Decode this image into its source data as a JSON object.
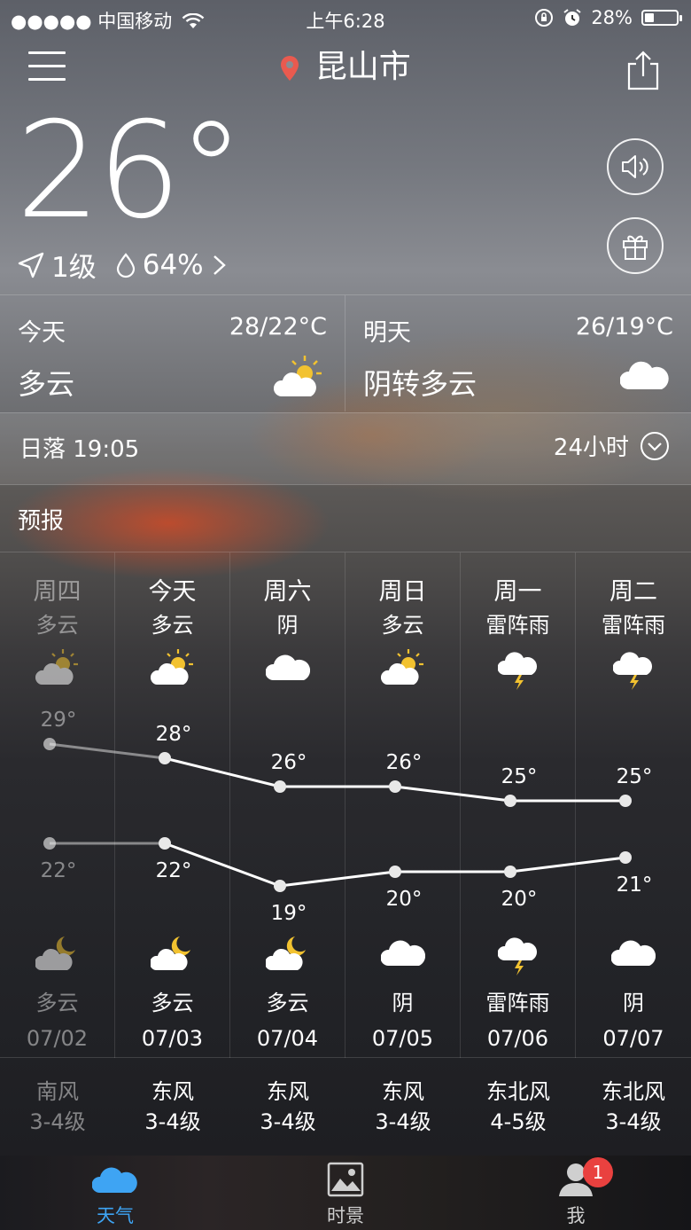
{
  "status_bar": {
    "carrier": "●●●●● 中国移动",
    "time": "上午6:28",
    "battery_text": "28%",
    "battery_level": 0.28
  },
  "header": {
    "city": "昆山市"
  },
  "current": {
    "temperature": "26°",
    "wind": "1级",
    "humidity": "64%"
  },
  "today": {
    "name": "今天",
    "range": "28/22°C",
    "condition": "多云",
    "icon": "partly-cloudy-icon"
  },
  "tomorrow": {
    "name": "明天",
    "range": "26/19°C",
    "condition": "阴转多云",
    "icon": "cloud-icon"
  },
  "sunset": {
    "label": "日落 19:05",
    "hours_toggle": "24小时"
  },
  "forecast_title": "预报",
  "forecast": [
    {
      "weekday": "周四",
      "day_cond": "多云",
      "day_icon": "partly-cloudy-icon",
      "high": "29°",
      "low": "22°",
      "night_icon": "moon-cloud-icon",
      "night_cond": "多云",
      "date": "07/02",
      "wind_dir": "南风",
      "wind_level": "3-4级",
      "past": true
    },
    {
      "weekday": "今天",
      "day_cond": "多云",
      "day_icon": "partly-cloudy-icon",
      "high": "28°",
      "low": "22°",
      "night_icon": "moon-cloud-icon",
      "night_cond": "多云",
      "date": "07/03",
      "wind_dir": "东风",
      "wind_level": "3-4级",
      "past": false
    },
    {
      "weekday": "周六",
      "day_cond": "阴",
      "day_icon": "cloud-icon",
      "high": "26°",
      "low": "19°",
      "night_icon": "moon-cloud-icon",
      "night_cond": "多云",
      "date": "07/04",
      "wind_dir": "东风",
      "wind_level": "3-4级",
      "past": false
    },
    {
      "weekday": "周日",
      "day_cond": "多云",
      "day_icon": "partly-cloudy-icon",
      "high": "26°",
      "low": "20°",
      "night_icon": "cloud-icon",
      "night_cond": "阴",
      "date": "07/05",
      "wind_dir": "东风",
      "wind_level": "3-4级",
      "past": false
    },
    {
      "weekday": "周一",
      "day_cond": "雷阵雨",
      "day_icon": "thunder-cloud-icon",
      "high": "25°",
      "low": "20°",
      "night_icon": "thunder-cloud-icon",
      "night_cond": "雷阵雨",
      "date": "07/06",
      "wind_dir": "东北风",
      "wind_level": "4-5级",
      "past": false
    },
    {
      "weekday": "周二",
      "day_cond": "雷阵雨",
      "day_icon": "thunder-cloud-icon",
      "high": "25°",
      "low": "21°",
      "night_icon": "cloud-icon",
      "night_cond": "阴",
      "date": "07/07",
      "wind_dir": "东北风",
      "wind_level": "3-4级",
      "past": false
    }
  ],
  "chart_data": {
    "type": "line",
    "categories": [
      "07/02",
      "07/03",
      "07/04",
      "07/05",
      "07/06",
      "07/07"
    ],
    "series": [
      {
        "values": [
          29,
          28,
          26,
          26,
          25,
          25
        ]
      },
      {
        "values": [
          22,
          22,
          19,
          20,
          20,
          21
        ]
      }
    ]
  },
  "tabs": [
    {
      "label": "天气",
      "icon": "cloud-icon",
      "active": true
    },
    {
      "label": "时景",
      "icon": "picture-icon",
      "active": false
    },
    {
      "label": "我",
      "icon": "user-icon",
      "active": false,
      "badge": "1"
    }
  ],
  "colors": {
    "accent": "#3ea4f3",
    "pin": "#e95a4f",
    "badge": "#e9413f",
    "sun": "#f2c230"
  }
}
